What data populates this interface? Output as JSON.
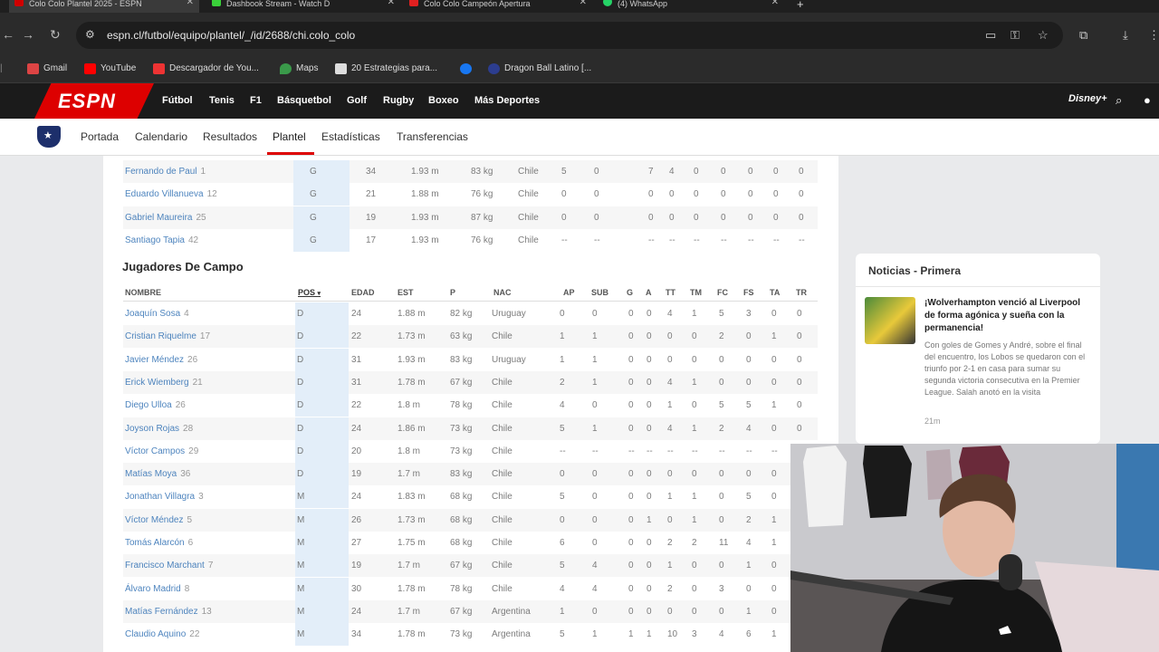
{
  "browser": {
    "tabs": [
      {
        "title": "Colo Colo Plantel 2025 - ESPN",
        "favicon_color": "#d00000",
        "active": true
      },
      {
        "title": "Dashbook Stream - Watch D",
        "favicon_color": "#3ad13a",
        "active": false
      },
      {
        "title": "Colo Colo Campeón Apertura",
        "favicon_color": "#e02020",
        "active": false
      },
      {
        "title": "(4) WhatsApp",
        "favicon_color": "#25d366",
        "active": false
      }
    ],
    "url": "espn.cl/futbol/equipo/plantel/_/id/2688/chi.colo_colo",
    "bookmarks": [
      {
        "label": "Gmail",
        "icon_color": "#d44"
      },
      {
        "label": "YouTube",
        "icon_color": "#f00"
      },
      {
        "label": "Descargador de You...",
        "icon_color": "#e33"
      },
      {
        "label": "Maps",
        "icon_color": "#3a9a4a"
      },
      {
        "label": "20 Estrategias para...",
        "icon_color": "#ddd"
      },
      {
        "label": "",
        "icon_color": "#1877f2"
      },
      {
        "label": "Dragon Ball Latino [...",
        "icon_color": "#2c3d8f"
      }
    ]
  },
  "espn": {
    "logo_text": "ESPN",
    "sports_nav": [
      "Fútbol",
      "Tenis",
      "F1",
      "Básquetbol",
      "Golf",
      "Rugby",
      "Boxeo",
      "Más Deportes"
    ],
    "disney_label": "Disney+",
    "team_nav": [
      "Portada",
      "Calendario",
      "Resultados",
      "Plantel",
      "Estadísticas",
      "Transferencias"
    ],
    "active_team_tab": "Plantel"
  },
  "goalkeepers": [
    {
      "name": "Fernando de Paul",
      "num": "1",
      "pos": "G",
      "edad": "34",
      "est": "1.93 m",
      "p": "83 kg",
      "nac": "Chile",
      "stats": [
        "5",
        "0",
        "",
        "7",
        "4",
        "0",
        "0",
        "0",
        "0",
        "0"
      ]
    },
    {
      "name": "Eduardo Villanueva",
      "num": "12",
      "pos": "G",
      "edad": "21",
      "est": "1.88 m",
      "p": "76 kg",
      "nac": "Chile",
      "stats": [
        "0",
        "0",
        "",
        "0",
        "0",
        "0",
        "0",
        "0",
        "0",
        "0"
      ]
    },
    {
      "name": "Gabriel Maureira",
      "num": "25",
      "pos": "G",
      "edad": "19",
      "est": "1.93 m",
      "p": "87 kg",
      "nac": "Chile",
      "stats": [
        "0",
        "0",
        "",
        "0",
        "0",
        "0",
        "0",
        "0",
        "0",
        "0"
      ]
    },
    {
      "name": "Santiago Tapia",
      "num": "42",
      "pos": "G",
      "edad": "17",
      "est": "1.93 m",
      "p": "76 kg",
      "nac": "Chile",
      "stats": [
        "--",
        "--",
        "",
        "--",
        "--",
        "--",
        "--",
        "--",
        "--",
        "--"
      ]
    }
  ],
  "outfield": {
    "title": "Jugadores De Campo",
    "headers": [
      "NOMBRE",
      "POS",
      "EDAD",
      "EST",
      "P",
      "NAC",
      "AP",
      "SUB",
      "G",
      "A",
      "TT",
      "TM",
      "FC",
      "FS",
      "TA",
      "TR"
    ],
    "players": [
      {
        "name": "Joaquín Sosa",
        "num": "4",
        "pos": "D",
        "edad": "24",
        "est": "1.88 m",
        "p": "82 kg",
        "nac": "Uruguay",
        "stats": [
          "0",
          "0",
          "0",
          "0",
          "4",
          "1",
          "5",
          "3",
          "0",
          "0"
        ]
      },
      {
        "name": "Cristian Riquelme",
        "num": "17",
        "pos": "D",
        "edad": "22",
        "est": "1.73 m",
        "p": "63 kg",
        "nac": "Chile",
        "stats": [
          "1",
          "1",
          "0",
          "0",
          "0",
          "0",
          "2",
          "0",
          "1",
          "0"
        ]
      },
      {
        "name": "Javier Méndez",
        "num": "26",
        "pos": "D",
        "edad": "31",
        "est": "1.93 m",
        "p": "83 kg",
        "nac": "Uruguay",
        "stats": [
          "1",
          "1",
          "0",
          "0",
          "0",
          "0",
          "0",
          "0",
          "0",
          "0"
        ]
      },
      {
        "name": "Erick Wiemberg",
        "num": "21",
        "pos": "D",
        "edad": "31",
        "est": "1.78 m",
        "p": "67 kg",
        "nac": "Chile",
        "stats": [
          "2",
          "1",
          "0",
          "0",
          "4",
          "1",
          "0",
          "0",
          "0",
          "0"
        ]
      },
      {
        "name": "Diego Ulloa",
        "num": "26",
        "pos": "D",
        "edad": "22",
        "est": "1.8 m",
        "p": "78 kg",
        "nac": "Chile",
        "stats": [
          "4",
          "0",
          "0",
          "0",
          "1",
          "0",
          "5",
          "5",
          "1",
          "0"
        ]
      },
      {
        "name": "Joyson Rojas",
        "num": "28",
        "pos": "D",
        "edad": "24",
        "est": "1.86 m",
        "p": "73 kg",
        "nac": "Chile",
        "stats": [
          "5",
          "1",
          "0",
          "0",
          "4",
          "1",
          "2",
          "4",
          "0",
          "0"
        ]
      },
      {
        "name": "Víctor Campos",
        "num": "29",
        "pos": "D",
        "edad": "20",
        "est": "1.8 m",
        "p": "73 kg",
        "nac": "Chile",
        "stats": [
          "--",
          "--",
          "--",
          "--",
          "--",
          "--",
          "--",
          "--",
          "--",
          "--"
        ]
      },
      {
        "name": "Matías Moya",
        "num": "36",
        "pos": "D",
        "edad": "19",
        "est": "1.7 m",
        "p": "83 kg",
        "nac": "Chile",
        "stats": [
          "0",
          "0",
          "0",
          "0",
          "0",
          "0",
          "0",
          "0",
          "0",
          ""
        ]
      },
      {
        "name": "Jonathan Villagra",
        "num": "3",
        "pos": "M",
        "edad": "24",
        "est": "1.83 m",
        "p": "68 kg",
        "nac": "Chile",
        "stats": [
          "5",
          "0",
          "0",
          "0",
          "1",
          "1",
          "0",
          "5",
          "0",
          ""
        ]
      },
      {
        "name": "Víctor Méndez",
        "num": "5",
        "pos": "M",
        "edad": "26",
        "est": "1.73 m",
        "p": "68 kg",
        "nac": "Chile",
        "stats": [
          "0",
          "0",
          "0",
          "1",
          "0",
          "1",
          "0",
          "2",
          "1",
          ""
        ]
      },
      {
        "name": "Tomás Alarcón",
        "num": "6",
        "pos": "M",
        "edad": "27",
        "est": "1.75 m",
        "p": "68 kg",
        "nac": "Chile",
        "stats": [
          "6",
          "0",
          "0",
          "0",
          "2",
          "2",
          "11",
          "4",
          "1",
          ""
        ]
      },
      {
        "name": "Francisco Marchant",
        "num": "7",
        "pos": "M",
        "edad": "19",
        "est": "1.7 m",
        "p": "67 kg",
        "nac": "Chile",
        "stats": [
          "5",
          "4",
          "0",
          "0",
          "1",
          "0",
          "0",
          "1",
          "0",
          ""
        ]
      },
      {
        "name": "Álvaro Madrid",
        "num": "8",
        "pos": "M",
        "edad": "30",
        "est": "1.78 m",
        "p": "78 kg",
        "nac": "Chile",
        "stats": [
          "4",
          "4",
          "0",
          "0",
          "2",
          "0",
          "3",
          "0",
          "0",
          ""
        ]
      },
      {
        "name": "Matías Fernández",
        "num": "13",
        "pos": "M",
        "edad": "24",
        "est": "1.7 m",
        "p": "67 kg",
        "nac": "Argentina",
        "stats": [
          "1",
          "0",
          "0",
          "0",
          "0",
          "0",
          "0",
          "1",
          "0",
          ""
        ]
      },
      {
        "name": "Claudio Aquino",
        "num": "22",
        "pos": "M",
        "edad": "34",
        "est": "1.78 m",
        "p": "73 kg",
        "nac": "Argentina",
        "stats": [
          "5",
          "1",
          "1",
          "1",
          "10",
          "3",
          "4",
          "6",
          "1",
          ""
        ]
      }
    ]
  },
  "news": {
    "header": "Noticias - Primera",
    "title": "¡Wolverhampton venció al Liverpool de forma agónica y sueña con la permanencia!",
    "body": "Con goles de Gomes y André, sobre el final del encuentro, los Lobos se quedaron con el triunfo por 2-1 en casa para sumar su segunda victoria consecutiva en la Premier League. Salah anotó en la visita",
    "time": "21m"
  },
  "colors": {
    "espn_red": "#d00000",
    "link_blue": "#2f6fb3",
    "pos_highlight": "#e3eef9"
  }
}
